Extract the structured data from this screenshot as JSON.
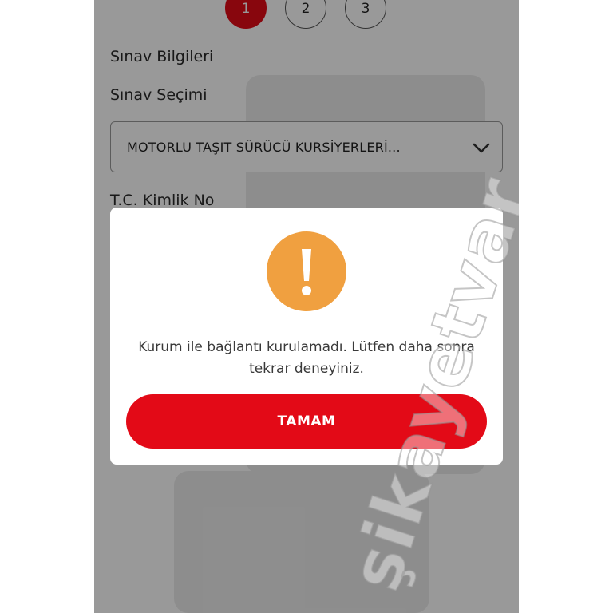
{
  "steps": [
    {
      "label": "1",
      "active": true
    },
    {
      "label": "2",
      "active": false
    },
    {
      "label": "3",
      "active": false
    }
  ],
  "form": {
    "section_title": "Sınav Bilgileri",
    "exam_select_label": "Sınav Seçimi",
    "exam_select_value": "MOTORLU TAŞIT SÜRÜCÜ KURSİYERLERİ...",
    "tc_label": "T.C. Kimlik No"
  },
  "dialog": {
    "icon": "exclamation-icon",
    "icon_color": "#f0a040",
    "message": "Kurum ile bağlantı kurulamadı. Lütfen daha sonra tekrar deneyiniz.",
    "ok_label": "TAMAM"
  },
  "watermark": {
    "text": "şikayetvar"
  },
  "colors": {
    "accent": "#e30a17",
    "overlay": "rgba(0,0,0,0.40)"
  }
}
